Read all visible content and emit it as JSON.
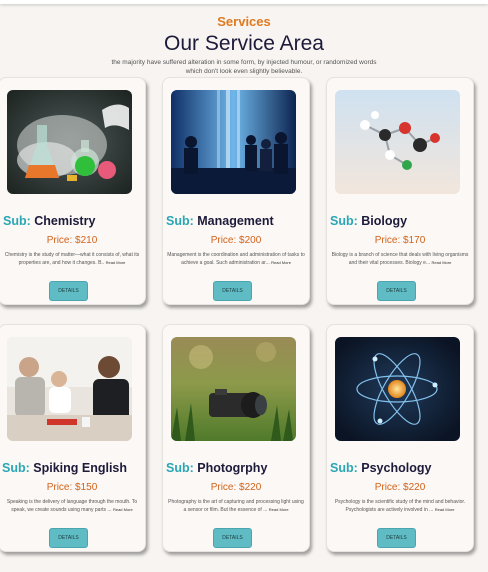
{
  "header": {
    "eyebrow": "Services",
    "title": "Our Service Area",
    "subtitle": "the majority have suffered alteration in some form, by injected humour, or randomized words which don't look even slightly believable."
  },
  "sub_prefix": "Sub:",
  "details_label": "DETAILS",
  "read_more_label": "Read More",
  "cards": [
    {
      "name": "Chemistry",
      "price": "Price: $210",
      "desc": "Chemistry is the study of matter—what it consists of, what its properties are, and how it changes. B..",
      "image": "chemistry-lab-image"
    },
    {
      "name": "Management",
      "price": "Price: $200",
      "desc": "Management is the coordination and administration of tasks to achieve a goal. Such administration ar...",
      "image": "business-meeting-image"
    },
    {
      "name": "Biology",
      "price": "Price: $170",
      "desc": "Biology is a branch of science that deals with living organisms and their vital processes. Biology e...",
      "image": "molecule-model-image"
    },
    {
      "name": "Spiking English",
      "price": "Price: $150",
      "desc": "Speaking is the delivery of language through the mouth. To speak, we create sounds using many parts ...",
      "image": "conversation-image"
    },
    {
      "name": "Photogrphy",
      "price": "Price: $220",
      "desc": "Photography is the art of capturing and processing light using a sensor or film. But the essence of ...",
      "image": "camera-on-grass-image"
    },
    {
      "name": "Psychology",
      "price": "Price: $220",
      "desc": "Psychology is the scientific study of the mind and behavior. Psychologists are actively involved in ...",
      "image": "atom-image"
    }
  ]
}
